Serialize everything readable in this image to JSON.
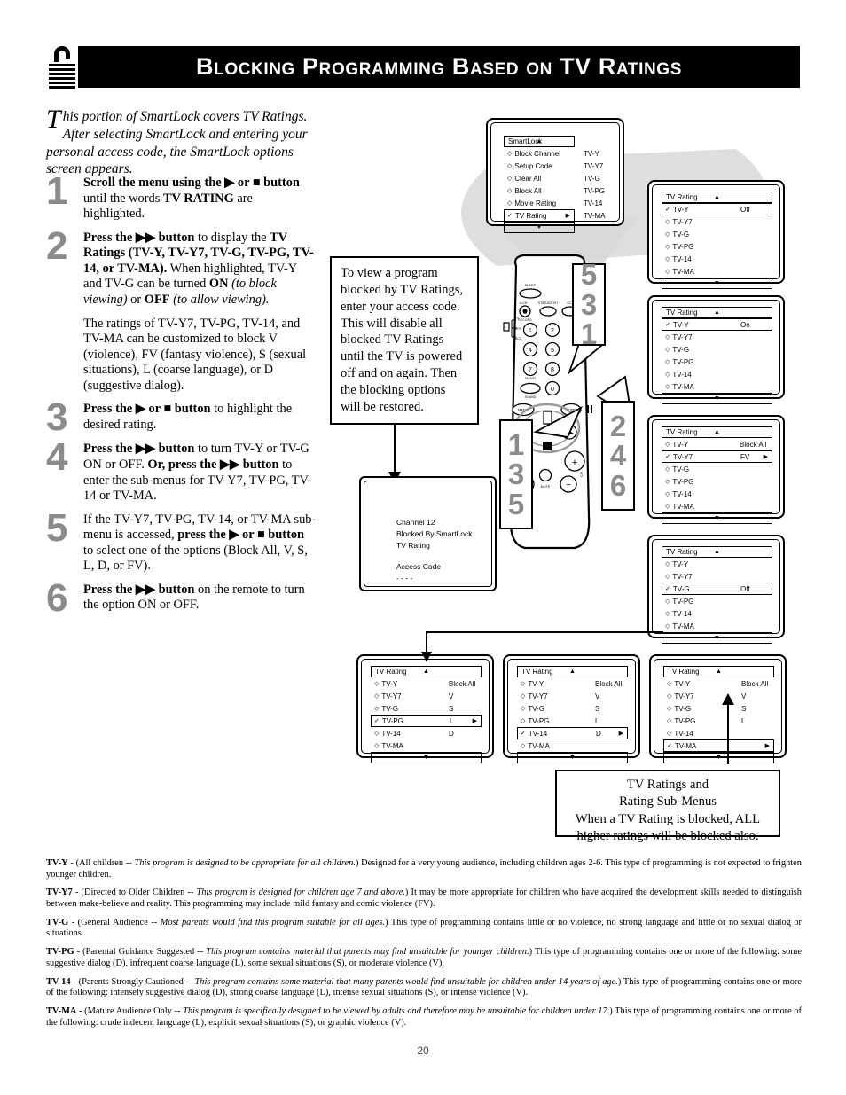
{
  "header": {
    "title": "Blocking Programming Based on TV Ratings",
    "lock_icon": "padlock-icon"
  },
  "intro": {
    "dropcap": "T",
    "text": "his portion of SmartLock covers TV Ratings. After selecting SmartLock and entering your personal access code, the SmartLock options screen appears."
  },
  "steps": [
    {
      "number": "1",
      "html": "<b>Scroll the menu using the ▶ or ■ button</b> until the words <b>TV RATING</b> are highlighted."
    },
    {
      "number": "2",
      "html": "<b>Press the ▶▶ button</b> to display the <b>TV Ratings (TV-Y, TV-Y7, TV-G, TV-PG, TV-14, or TV-MA).</b> When highlighted, TV-Y and TV-G can be turned <b>ON</b> <i>(to block viewing)</i> or <b>OFF</b> <i>(to allow viewing).</i>",
      "extra": "The ratings of TV-Y7, TV-PG, TV-14, and TV-MA can be customized to block V (violence), FV (fantasy violence), S (sexual situations), L (coarse language), or D (suggestive dialog)."
    },
    {
      "number": "3",
      "html": "<b>Press the ▶ or ■ button</b> to highlight the desired rating."
    },
    {
      "number": "4",
      "html": "<b>Press the ▶▶ button</b> to turn TV-Y or TV-G ON or OFF. <b>Or, press the ▶▶ button</b> to enter the sub-menus for TV-Y7, TV-PG, TV-14 or TV-MA."
    },
    {
      "number": "5",
      "html": "If the TV-Y7, TV-PG, TV-14, or TV-MA sub-menu is accessed, <b>press the ▶ or ■ button</b> to select one of the options (Block All, V, S, L, D, or FV)."
    },
    {
      "number": "6",
      "html": "<b>Press the ▶▶ button</b> on the remote to turn the option ON or OFF."
    }
  ],
  "note_box": {
    "text": "To view a program blocked by TV Ratings, enter your access code. This will disable all blocked TV Ratings until the TV is powered off and on again. Then the blocking options will be restored."
  },
  "smartlock_menu": {
    "title": "SmartLock",
    "up_arrow": "▲",
    "down_arrow": "▼",
    "rows": [
      {
        "label": "Block Channel",
        "bullet": "◇",
        "selected": false
      },
      {
        "label": "Setup Code",
        "bullet": "◇",
        "selected": false
      },
      {
        "label": "Clear All",
        "bullet": "◇",
        "selected": false
      },
      {
        "label": "Block All",
        "bullet": "◇",
        "selected": false
      },
      {
        "label": "Movie Rating",
        "bullet": "◇",
        "selected": false
      },
      {
        "label": "TV Rating",
        "bullet": "✓",
        "selected": true,
        "arrow": "▶"
      }
    ],
    "right_column": [
      "TV-Y",
      "TV-Y7",
      "TV-G",
      "TV-PG",
      "TV-14",
      "TV-MA"
    ]
  },
  "tv_screen": {
    "line1": "Channel 12",
    "line2": "Blocked By SmartLock",
    "line3": "TV Rating",
    "line4": "Access Code",
    "line5": "- - - -"
  },
  "rating_menus": [
    {
      "id": "menu-tvy-off",
      "title": "TV Rating",
      "up_arrow": "▲",
      "down_arrow": "▼",
      "rows": [
        {
          "label": "TV-Y",
          "bullet": "✓",
          "selected": true,
          "value": "Off"
        },
        {
          "label": "TV-Y7",
          "bullet": "◇",
          "selected": false,
          "value": ""
        },
        {
          "label": "TV-G",
          "bullet": "◇",
          "selected": false,
          "value": ""
        },
        {
          "label": "TV-PG",
          "bullet": "◇",
          "selected": false,
          "value": ""
        },
        {
          "label": "TV-14",
          "bullet": "◇",
          "selected": false,
          "value": ""
        },
        {
          "label": "TV-MA",
          "bullet": "◇",
          "selected": false,
          "value": ""
        }
      ]
    },
    {
      "id": "menu-tvy-on",
      "title": "TV Rating",
      "up_arrow": "▲",
      "down_arrow": "▼",
      "rows": [
        {
          "label": "TV-Y",
          "bullet": "✓",
          "selected": true,
          "value": "On"
        },
        {
          "label": "TV-Y7",
          "bullet": "◇",
          "selected": false,
          "value": ""
        },
        {
          "label": "TV-G",
          "bullet": "◇",
          "selected": false,
          "value": ""
        },
        {
          "label": "TV-PG",
          "bullet": "◇",
          "selected": false,
          "value": ""
        },
        {
          "label": "TV-14",
          "bullet": "◇",
          "selected": false,
          "value": ""
        },
        {
          "label": "TV-MA",
          "bullet": "◇",
          "selected": false,
          "value": ""
        }
      ]
    },
    {
      "id": "menu-tvy7-fv",
      "title": "TV Rating",
      "up_arrow": "▲",
      "down_arrow": "▼",
      "rows": [
        {
          "label": "TV-Y",
          "bullet": "◇",
          "selected": false,
          "value": "Block All"
        },
        {
          "label": "TV-Y7",
          "bullet": "✓",
          "selected": true,
          "value": "FV",
          "arrow": "▶"
        },
        {
          "label": "TV-G",
          "bullet": "◇",
          "selected": false,
          "value": ""
        },
        {
          "label": "TV-PG",
          "bullet": "◇",
          "selected": false,
          "value": ""
        },
        {
          "label": "TV-14",
          "bullet": "◇",
          "selected": false,
          "value": ""
        },
        {
          "label": "TV-MA",
          "bullet": "◇",
          "selected": false,
          "value": ""
        }
      ]
    },
    {
      "id": "menu-tvg-off",
      "title": "TV Rating",
      "up_arrow": "▲",
      "down_arrow": "▼",
      "rows": [
        {
          "label": "TV-Y",
          "bullet": "◇",
          "selected": false,
          "value": ""
        },
        {
          "label": "TV-Y7",
          "bullet": "◇",
          "selected": false,
          "value": ""
        },
        {
          "label": "TV-G",
          "bullet": "✓",
          "selected": true,
          "value": "Off"
        },
        {
          "label": "TV-PG",
          "bullet": "◇",
          "selected": false,
          "value": ""
        },
        {
          "label": "TV-14",
          "bullet": "◇",
          "selected": false,
          "value": ""
        },
        {
          "label": "TV-MA",
          "bullet": "◇",
          "selected": false,
          "value": ""
        }
      ]
    },
    {
      "id": "menu-tvpg",
      "title": "TV Rating",
      "up_arrow": "▲",
      "down_arrow": "▼",
      "rows": [
        {
          "label": "TV-Y",
          "bullet": "◇",
          "selected": false,
          "value": "Block All"
        },
        {
          "label": "TV-Y7",
          "bullet": "◇",
          "selected": false,
          "value": "V"
        },
        {
          "label": "TV-G",
          "bullet": "◇",
          "selected": false,
          "value": "S"
        },
        {
          "label": "TV-PG",
          "bullet": "✓",
          "selected": true,
          "value": "L",
          "arrow": "▶"
        },
        {
          "label": "TV-14",
          "bullet": "◇",
          "selected": false,
          "value": "D"
        },
        {
          "label": "TV-MA",
          "bullet": "◇",
          "selected": false,
          "value": ""
        }
      ]
    },
    {
      "id": "menu-tv14",
      "title": "TV Rating",
      "up_arrow": "▲",
      "down_arrow": "▼",
      "rows": [
        {
          "label": "TV-Y",
          "bullet": "◇",
          "selected": false,
          "value": "Block All"
        },
        {
          "label": "TV-Y7",
          "bullet": "◇",
          "selected": false,
          "value": "V"
        },
        {
          "label": "TV-G",
          "bullet": "◇",
          "selected": false,
          "value": "S"
        },
        {
          "label": "TV-PG",
          "bullet": "◇",
          "selected": false,
          "value": "L"
        },
        {
          "label": "TV-14",
          "bullet": "✓",
          "selected": true,
          "value": "D",
          "arrow": "▶"
        },
        {
          "label": "TV-MA",
          "bullet": "◇",
          "selected": false,
          "value": ""
        }
      ]
    },
    {
      "id": "menu-tvma",
      "title": "TV Rating",
      "up_arrow": "▲",
      "down_arrow": "▼",
      "rows": [
        {
          "label": "TV-Y",
          "bullet": "◇",
          "selected": false,
          "value": "Block All"
        },
        {
          "label": "TV-Y7",
          "bullet": "◇",
          "selected": false,
          "value": "V"
        },
        {
          "label": "TV-G",
          "bullet": "◇",
          "selected": false,
          "value": "S"
        },
        {
          "label": "TV-PG",
          "bullet": "◇",
          "selected": false,
          "value": "L"
        },
        {
          "label": "TV-14",
          "bullet": "◇",
          "selected": false,
          "value": ""
        },
        {
          "label": "TV-MA",
          "bullet": "✓",
          "selected": true,
          "value": "",
          "arrow": "▶"
        }
      ]
    }
  ],
  "callouts": [
    {
      "id": "callout-531",
      "numbers": "5\n3\n1"
    },
    {
      "id": "callout-135",
      "numbers": "1\n3\n5"
    },
    {
      "id": "callout-246",
      "numbers": "2\n4\n6"
    }
  ],
  "remote": {
    "labels": {
      "sleep": "SLEEP",
      "a_ch": "A-CH",
      "status_exit": "STATUS/EXIT",
      "cc": "CC",
      "record": "RECORD",
      "tv": "TV",
      "vcr": "VCR",
      "acc": "ACC",
      "smart": "SMART",
      "sound": "SOUND",
      "menu": "MENU",
      "surf": "SURF",
      "mute": "MUTE",
      "ch": "CH",
      "vol": "VOL"
    },
    "keys": [
      "1",
      "2",
      "4",
      "5",
      "7",
      "8",
      "0"
    ]
  },
  "caption": {
    "line1": "TV Ratings and",
    "line2": "Rating Sub-Menus",
    "line3": "When a TV Rating is blocked, ALL",
    "line4": "higher ratings will be blocked also."
  },
  "definitions": [
    {
      "term": "TV-Y",
      "html": "<b>TV-Y</b> - (All children -- <i>This program is designed to be appropriate for all children.</i>) Designed for a very young audience, including children ages 2-6. This type of programming is not expected to frighten younger children."
    },
    {
      "term": "TV-Y7",
      "html": "<b>TV-Y7</b> - (Directed to Older Children -- <i>This program is designed for children age 7 and above.</i>) It may be more appropriate for children who have acquired the development skills needed to distinguish between make-believe and reality. This programming may include mild fantasy and comic violence (FV)."
    },
    {
      "term": "TV-G",
      "html": "<b>TV-G</b> - (General Audience -- <i>Most parents would find this program suitable for all ages.</i>) This type of programming contains little or no violence, no strong language and little or no sexual dialog or situations."
    },
    {
      "term": "TV-PG",
      "html": "<b>TV-PG</b> - (Parental Guidance Suggested -- <i>This program contains material that parents may find unsuitable for younger children.</i>) This type of programming contains one or more of the following: some suggestive dialog (D), infrequent coarse language (L), some sexual situations (S), or moderate violence (V)."
    },
    {
      "term": "TV-14",
      "html": "<b>TV-14</b> - (Parents Strongly Cautioned -- <i>This program contains some material that many parents would find unsuitable for children under 14 years of age.</i>) This type of programming contains one or more of the following: intensely suggestive dialog (D), strong coarse language (L), intense sexual situations (S), or intense violence (V)."
    },
    {
      "term": "TV-MA",
      "html": "<b>TV-MA</b> - (Mature Audience Only -- <i>This program is specifically designed to be viewed by adults and therefore may be unsuitable for children under 17.</i>) This type of programming contains one or more of the following: crude indecent language (L), explicit sexual situations (S), or graphic violence (V)."
    }
  ],
  "page_number": "20"
}
